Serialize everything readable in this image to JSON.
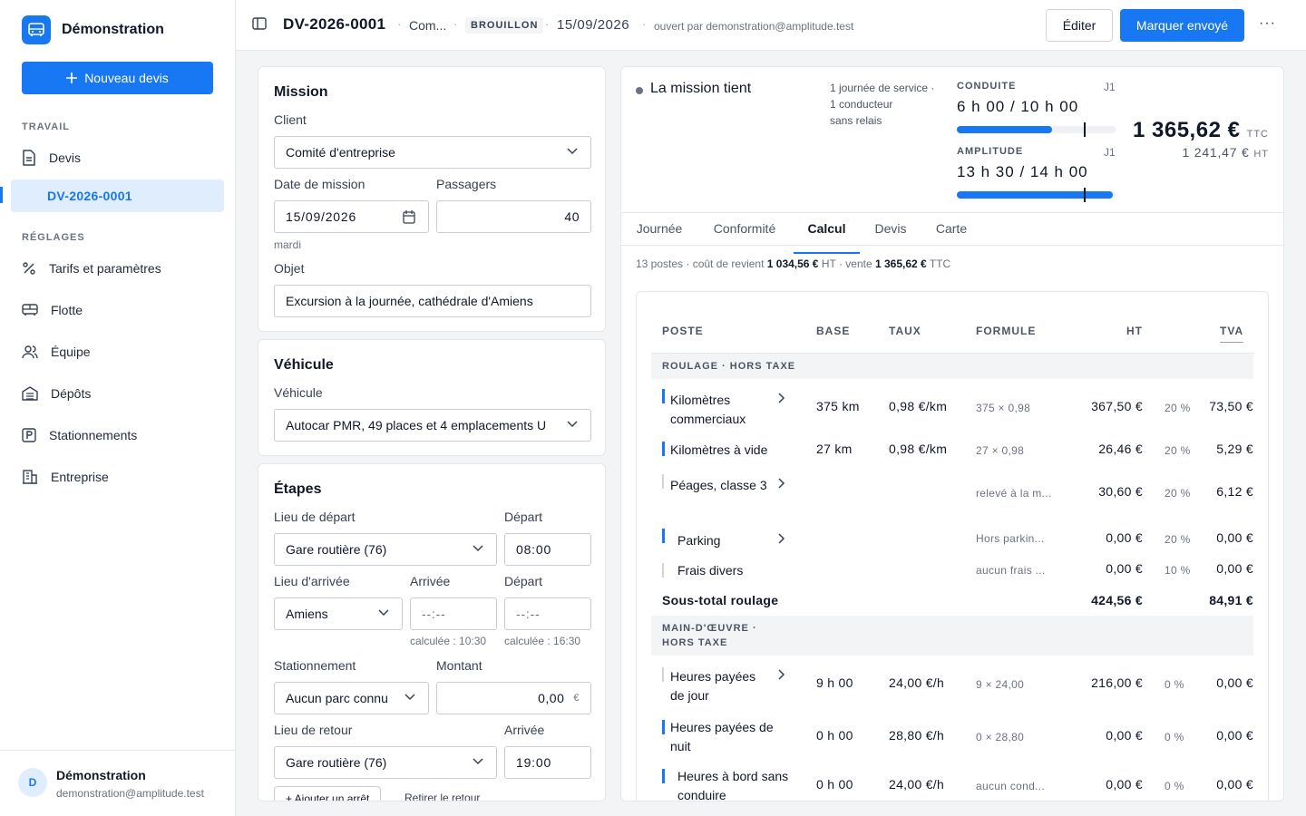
{
  "sidebar": {
    "brand": "Démonstration",
    "new_quote": "Nouveau devis",
    "section_work": "TRAVAIL",
    "item_quotes": "Devis",
    "item_current": "DV-2026-0001",
    "section_settings": "RÉGLAGES",
    "items": [
      "Tarifs et paramètres",
      "Flotte",
      "Équipe",
      "Dépôts",
      "Stationnements",
      "Entreprise"
    ],
    "user": {
      "initial": "D",
      "name": "Démonstration",
      "email": "demonstration@amplitude.test"
    }
  },
  "header": {
    "ref": "DV-2026-0001",
    "client_short": "Com...",
    "badge": "BROUILLON",
    "date": "15/09/2026",
    "opened_by": "ouvert par demonstration@amplitude.test",
    "edit": "Éditer",
    "mark_sent": "Marquer envoyé",
    "more": "···"
  },
  "mission": {
    "title": "Mission",
    "client_label": "Client",
    "client_value": "Comité d'entreprise",
    "date_label": "Date de mission",
    "date_value": "15/09/2026",
    "weekday": "mardi",
    "passengers_label": "Passagers",
    "passengers_value": "40",
    "object_label": "Objet",
    "object_value": "Excursion à la journée, cathédrale d'Amiens"
  },
  "vehicle": {
    "title": "Véhicule",
    "label": "Véhicule",
    "value": "Autocar PMR, 49 places et 4 emplacements U"
  },
  "steps": {
    "title": "Étapes",
    "departure_place_label": "Lieu de départ",
    "departure_place": "Gare routière (76)",
    "departure_time_label": "Départ",
    "departure_time": "08:00",
    "arrival_place_label": "Lieu d'arrivée",
    "arrival_place": "Amiens",
    "arrival_time_label": "Arrivée",
    "arrival_time": "--:--",
    "arrival_hint": "calculée : 10:30",
    "leave_time_label": "Départ",
    "leave_time": "--:--",
    "leave_hint": "calculée : 16:30",
    "parking_label": "Stationnement",
    "parking_value": "Aucun parc connu",
    "amount_label": "Montant",
    "amount_value": "0,00",
    "amount_unit": "€",
    "return_place_label": "Lieu de retour",
    "return_place": "Gare routière (76)",
    "return_time_label": "Arrivée",
    "return_time": "19:00",
    "add_stop": "+ Ajouter un arrêt",
    "remove_return": "Retirer le retour"
  },
  "overview": {
    "status": "La mission tient",
    "meta": [
      "1 journée de service ·",
      "1 conducteur",
      "sans relais"
    ],
    "driving": {
      "label": "CONDUITE",
      "day": "J1",
      "value": "6 h 00 / 10 h 00",
      "fill": 0.6
    },
    "amplitude": {
      "label": "AMPLITUDE",
      "day": "J1",
      "value": "13 h 30 / 14 h 00",
      "fill": 0.98
    },
    "price_ttc": "1 365,62 €",
    "ttc": "TTC",
    "price_ht": "1 241,47 €",
    "ht": "HT"
  },
  "tabs": [
    "Journée",
    "Conformité",
    "Calcul",
    "Devis",
    "Carte"
  ],
  "calc": {
    "summary_prefix": "13 postes · coût de revient",
    "cost": "1 034,56 €",
    "ht": "HT",
    "sale_prefix": "· vente",
    "sale": "1 365,62 €",
    "ttc": "TTC",
    "headers": {
      "poste": "POSTE",
      "base": "BASE",
      "taux": "TAUX",
      "formule": "FORMULE",
      "ht": "HT",
      "tva": "TVA"
    },
    "group1": "ROULAGE · HORS TAXE",
    "rows1": [
      {
        "name": "Kilomètres commerciaux",
        "base": "375 km",
        "rate": "0,98 €/km",
        "formula": "375 × 0,98",
        "ht": "367,50 €",
        "vat_rate": "20 %",
        "vat": "73,50 €"
      },
      {
        "name": "Kilomètres à vide",
        "base": "27 km",
        "rate": "0,98 €/km",
        "formula": "27 × 0,98",
        "ht": "26,46 €",
        "vat_rate": "20 %",
        "vat": "5,29 €"
      },
      {
        "name": "Péages, classe 3",
        "base": "",
        "rate": "",
        "formula": "relevé à la m...",
        "ht": "30,60 €",
        "vat_rate": "20 %",
        "vat": "6,12 €"
      },
      {
        "name": "Parking",
        "base": "",
        "rate": "",
        "formula": "Hors parkin...",
        "ht": "0,00 €",
        "vat_rate": "20 %",
        "vat": "0,00 €"
      },
      {
        "name": "Frais divers",
        "base": "",
        "rate": "",
        "formula": "aucun frais ...",
        "ht": "0,00 €",
        "vat_rate": "10 %",
        "vat": "0,00 €"
      }
    ],
    "subtotal1": {
      "label": "Sous-total roulage",
      "ht": "424,56 €",
      "vat": "84,91 €"
    },
    "group2": "MAIN-D'ŒUVRE · HORS TAXE",
    "rows2": [
      {
        "name": "Heures payées de jour",
        "base": "9 h 00",
        "rate": "24,00 €/h",
        "formula": "9 × 24,00",
        "ht": "216,00 €",
        "vat_rate": "0 %",
        "vat": "0,00 €"
      },
      {
        "name": "Heures payées de nuit",
        "base": "0 h 00",
        "rate": "28,80 €/h",
        "formula": "0 × 28,80",
        "ht": "0,00 €",
        "vat_rate": "0 %",
        "vat": "0,00 €"
      },
      {
        "name": "Heures à bord sans conduire",
        "base": "0 h 00",
        "rate": "24,00 €/h",
        "formula": "aucun cond...",
        "ht": "0,00 €",
        "vat_rate": "0 %",
        "vat": "0,00 €"
      }
    ]
  },
  "colors": {
    "accent": "#1877f2",
    "accent_light": "#e0edfd"
  }
}
